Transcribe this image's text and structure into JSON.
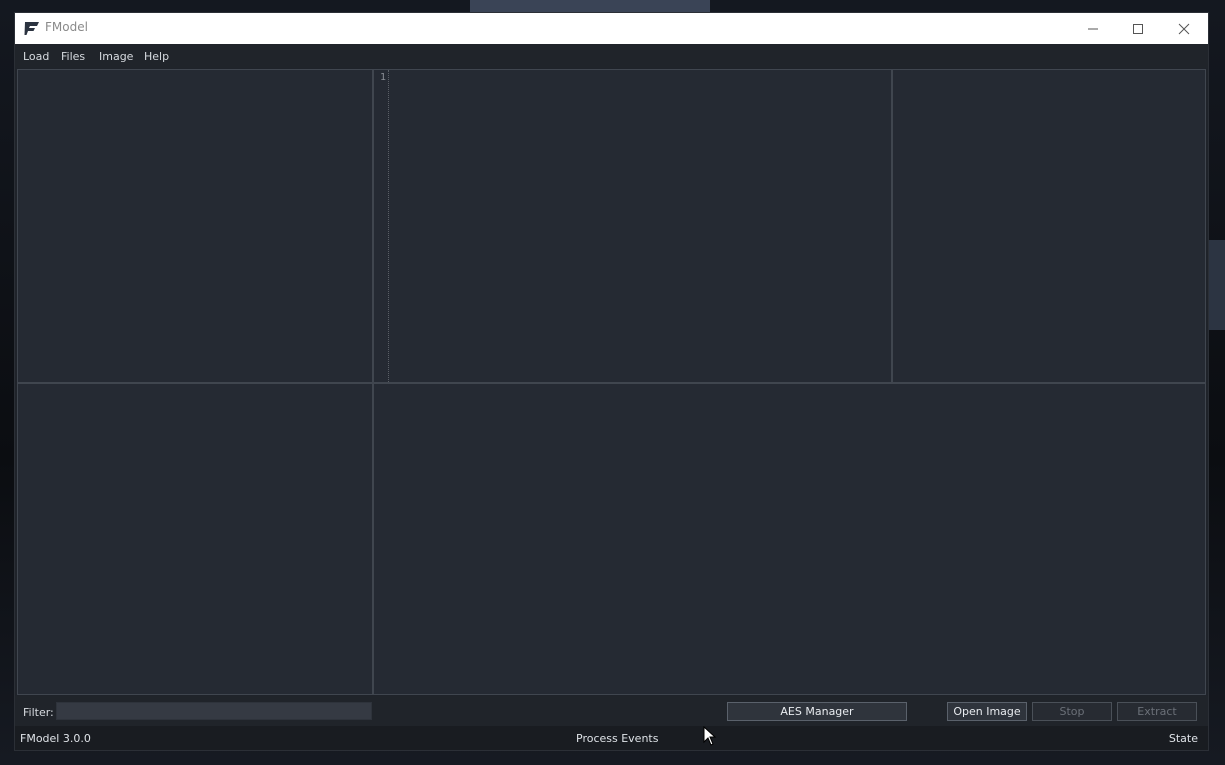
{
  "window": {
    "title": "FModel"
  },
  "menu": {
    "items": [
      "Load",
      "Files",
      "Image",
      "Help"
    ]
  },
  "editor": {
    "line_numbers": [
      "1"
    ]
  },
  "bottom": {
    "filter_label": "Filter:",
    "filter_value": "",
    "aes_manager": "AES Manager",
    "open_image": "Open Image",
    "stop": "Stop",
    "extract": "Extract"
  },
  "status": {
    "version": "FModel 3.0.0",
    "process_events": "Process Events",
    "state": "State"
  },
  "colors": {
    "pane_bg": "#252a33",
    "pane_border": "#40464f",
    "titlebar": "#ffffff",
    "menubar": "#20242a",
    "statusbar": "#191c21"
  }
}
